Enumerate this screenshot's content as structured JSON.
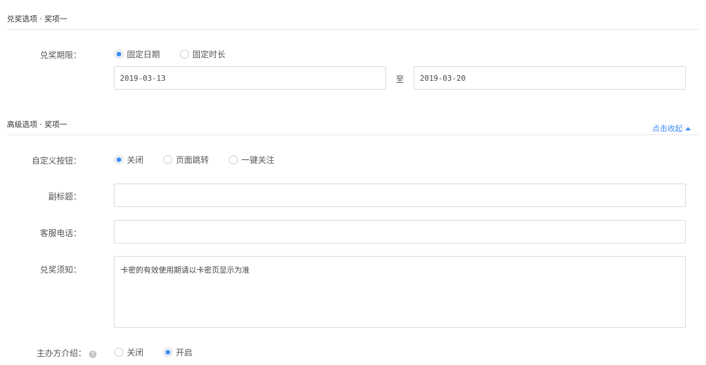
{
  "redeem_section": {
    "title": "兑奖选项 · 奖项一",
    "period_label": "兑奖期限：",
    "period_options": [
      {
        "label": "固定日期",
        "checked": true
      },
      {
        "label": "固定时长",
        "checked": false
      }
    ],
    "start_date": "2019-03-13",
    "to_label": "至",
    "end_date": "2019-03-20"
  },
  "advanced_section": {
    "title": "高级选项 · 奖项一",
    "collapse_label": "点击收起",
    "custom_button_label": "自定义按钮：",
    "custom_button_options": [
      {
        "label": "关闭",
        "checked": true
      },
      {
        "label": "页面跳转",
        "checked": false
      },
      {
        "label": "一键关注",
        "checked": false
      }
    ],
    "subtitle_label": "副标题：",
    "subtitle_value": "",
    "phone_label": "客服电话：",
    "phone_value": "",
    "notice_label": "兑奖须知：",
    "notice_value": "卡密的有效使用期请以卡密页显示为准",
    "organizer_label": "主办方介绍：",
    "help_icon": "?",
    "organizer_options": [
      {
        "label": "关闭",
        "checked": false
      },
      {
        "label": "开启",
        "checked": true
      }
    ]
  },
  "colors": {
    "accent": "#3f8ef7",
    "border": "#d9d9d9",
    "divider": "#e6e6e6"
  }
}
